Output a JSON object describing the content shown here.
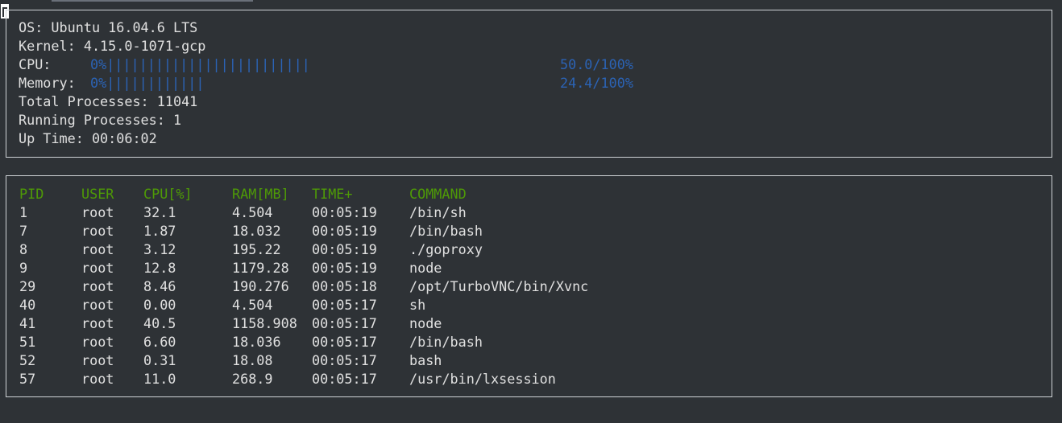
{
  "system": {
    "os_label": "OS:",
    "os_value": "Ubuntu 16.04.6 LTS",
    "kernel_label": "Kernel:",
    "kernel_value": "4.15.0-1071-gcp",
    "cpu_label": "CPU:",
    "cpu_bar": "0%|||||||||||||||||||||||||",
    "cpu_usage": "50.0/100%",
    "memory_label": "Memory:",
    "memory_bar": "0%||||||||||||",
    "memory_usage": "24.4/100%",
    "total_processes_label": "Total Processes:",
    "total_processes_value": "11041",
    "running_processes_label": "Running Processes:",
    "running_processes_value": "1",
    "uptime_label": "Up Time:",
    "uptime_value": "00:06:02"
  },
  "colors": {
    "bar_blue": "#2b63b5",
    "header_green": "#4e9a06",
    "background": "#2e3236",
    "text": "#e0e0e0"
  },
  "processes": {
    "headers": {
      "pid": "PID",
      "user": "USER",
      "cpu": "CPU[%]",
      "ram": "RAM[MB]",
      "time": "TIME+",
      "command": "COMMAND"
    },
    "rows": [
      {
        "pid": "1",
        "user": "root",
        "cpu": "32.1",
        "ram": "4.504",
        "time": "00:05:19",
        "command": "/bin/sh"
      },
      {
        "pid": "7",
        "user": "root",
        "cpu": "1.87",
        "ram": "18.032",
        "time": "00:05:19",
        "command": "/bin/bash"
      },
      {
        "pid": "8",
        "user": "root",
        "cpu": "3.12",
        "ram": "195.22",
        "time": "00:05:19",
        "command": "./goproxy"
      },
      {
        "pid": "9",
        "user": "root",
        "cpu": "12.8",
        "ram": "1179.28",
        "time": "00:05:19",
        "command": "node"
      },
      {
        "pid": "29",
        "user": "root",
        "cpu": "8.46",
        "ram": "190.276",
        "time": "00:05:18",
        "command": "/opt/TurboVNC/bin/Xvnc"
      },
      {
        "pid": "40",
        "user": "root",
        "cpu": "0.00",
        "ram": "4.504",
        "time": "00:05:17",
        "command": "sh"
      },
      {
        "pid": "41",
        "user": "root",
        "cpu": "40.5",
        "ram": "1158.908",
        "time": "00:05:17",
        "command": "node"
      },
      {
        "pid": "51",
        "user": "root",
        "cpu": "6.60",
        "ram": "18.036",
        "time": "00:05:17",
        "command": "/bin/bash"
      },
      {
        "pid": "52",
        "user": "root",
        "cpu": "0.31",
        "ram": "18.08",
        "time": "00:05:17",
        "command": "bash"
      },
      {
        "pid": "57",
        "user": "root",
        "cpu": "11.0",
        "ram": "268.9",
        "time": "00:05:17",
        "command": "/usr/bin/lxsession"
      }
    ]
  }
}
